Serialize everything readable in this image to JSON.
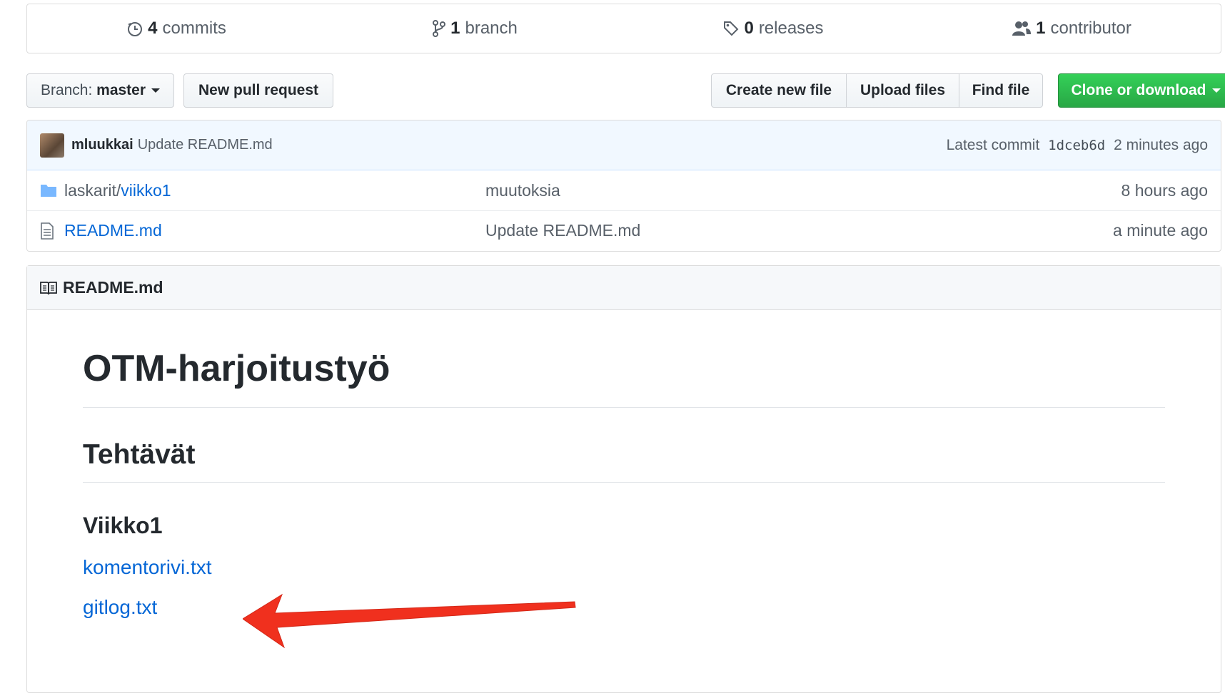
{
  "summary": {
    "commits": {
      "count": "4",
      "label": "commits"
    },
    "branches": {
      "count": "1",
      "label": "branch"
    },
    "releases": {
      "count": "0",
      "label": "releases"
    },
    "contributors": {
      "count": "1",
      "label": "contributor"
    }
  },
  "actions": {
    "branch_prefix": "Branch:",
    "branch_name": "master",
    "new_pull_request": "New pull request",
    "create_new_file": "Create new file",
    "upload_files": "Upload files",
    "find_file": "Find file",
    "clone_or_download": "Clone or download"
  },
  "latest_commit": {
    "author": "mluukkai",
    "message": "Update README.md",
    "prefix": "Latest commit",
    "sha": "1dceb6d",
    "age": "2 minutes ago"
  },
  "files": [
    {
      "type": "directory",
      "dim_part": "laskarit/",
      "link_part": "viikko1",
      "commit_message": "muutoksia",
      "age": "8 hours ago"
    },
    {
      "type": "file",
      "dim_part": "",
      "link_part": "README.md",
      "commit_message": "Update README.md",
      "age": "a minute ago"
    }
  ],
  "readme": {
    "filename": "README.md",
    "h1": "OTM-harjoitustyö",
    "h2": "Tehtävät",
    "h3": "Viikko1",
    "links": [
      "komentorivi.txt",
      "gitlog.txt"
    ]
  },
  "colors": {
    "link": "#0366d6",
    "green_button": "#28a745",
    "commit_bar": "#f1f8ff",
    "annotation_arrow": "#f0301e"
  }
}
